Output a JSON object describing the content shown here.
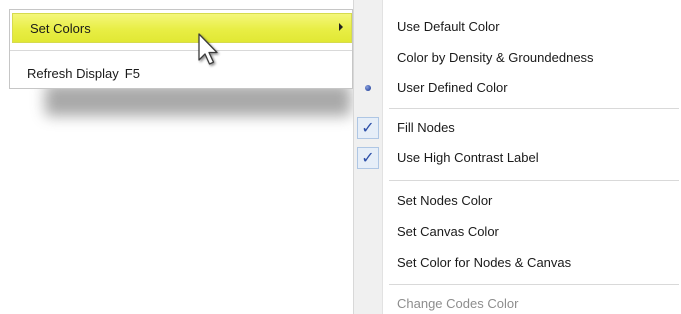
{
  "context_menu": {
    "items": [
      {
        "label": "Set Colors",
        "has_submenu": true,
        "highlighted": true
      },
      {
        "label": "Refresh Display",
        "shortcut": "F5"
      }
    ],
    "highlight_color": "#e8ee45"
  },
  "cursor": {
    "icon": "arrow-pointer-icon"
  },
  "submenu": {
    "groups": [
      {
        "items": [
          {
            "label": "Use Default Color",
            "state": "none"
          },
          {
            "label": "Color by Density & Groundedness",
            "state": "none"
          },
          {
            "label": "User Defined Color",
            "state": "radio-selected"
          }
        ]
      },
      {
        "items": [
          {
            "label": "Fill Nodes",
            "state": "checked"
          },
          {
            "label": "Use High Contrast Label",
            "state": "checked"
          }
        ]
      },
      {
        "items": [
          {
            "label": "Set Nodes Color"
          },
          {
            "label": "Set Canvas Color"
          },
          {
            "label": "Set Color for Nodes & Canvas"
          }
        ]
      },
      {
        "items": [
          {
            "label": "Change Codes Color",
            "disabled": true
          }
        ]
      }
    ],
    "check_color": "#2c4fa8",
    "radio_color": "#3552a8"
  }
}
